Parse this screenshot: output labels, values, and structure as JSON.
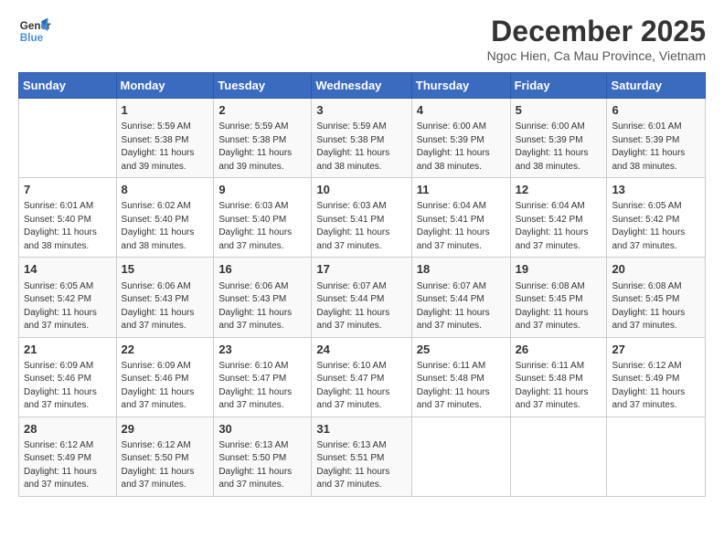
{
  "logo": {
    "line1": "General",
    "line2": "Blue"
  },
  "title": "December 2025",
  "location": "Ngoc Hien, Ca Mau Province, Vietnam",
  "days_of_week": [
    "Sunday",
    "Monday",
    "Tuesday",
    "Wednesday",
    "Thursday",
    "Friday",
    "Saturday"
  ],
  "weeks": [
    [
      {
        "num": "",
        "detail": ""
      },
      {
        "num": "1",
        "detail": "Sunrise: 5:59 AM\nSunset: 5:38 PM\nDaylight: 11 hours\nand 39 minutes."
      },
      {
        "num": "2",
        "detail": "Sunrise: 5:59 AM\nSunset: 5:38 PM\nDaylight: 11 hours\nand 39 minutes."
      },
      {
        "num": "3",
        "detail": "Sunrise: 5:59 AM\nSunset: 5:38 PM\nDaylight: 11 hours\nand 38 minutes."
      },
      {
        "num": "4",
        "detail": "Sunrise: 6:00 AM\nSunset: 5:39 PM\nDaylight: 11 hours\nand 38 minutes."
      },
      {
        "num": "5",
        "detail": "Sunrise: 6:00 AM\nSunset: 5:39 PM\nDaylight: 11 hours\nand 38 minutes."
      },
      {
        "num": "6",
        "detail": "Sunrise: 6:01 AM\nSunset: 5:39 PM\nDaylight: 11 hours\nand 38 minutes."
      }
    ],
    [
      {
        "num": "7",
        "detail": "Sunrise: 6:01 AM\nSunset: 5:40 PM\nDaylight: 11 hours\nand 38 minutes."
      },
      {
        "num": "8",
        "detail": "Sunrise: 6:02 AM\nSunset: 5:40 PM\nDaylight: 11 hours\nand 38 minutes."
      },
      {
        "num": "9",
        "detail": "Sunrise: 6:03 AM\nSunset: 5:40 PM\nDaylight: 11 hours\nand 37 minutes."
      },
      {
        "num": "10",
        "detail": "Sunrise: 6:03 AM\nSunset: 5:41 PM\nDaylight: 11 hours\nand 37 minutes."
      },
      {
        "num": "11",
        "detail": "Sunrise: 6:04 AM\nSunset: 5:41 PM\nDaylight: 11 hours\nand 37 minutes."
      },
      {
        "num": "12",
        "detail": "Sunrise: 6:04 AM\nSunset: 5:42 PM\nDaylight: 11 hours\nand 37 minutes."
      },
      {
        "num": "13",
        "detail": "Sunrise: 6:05 AM\nSunset: 5:42 PM\nDaylight: 11 hours\nand 37 minutes."
      }
    ],
    [
      {
        "num": "14",
        "detail": "Sunrise: 6:05 AM\nSunset: 5:42 PM\nDaylight: 11 hours\nand 37 minutes."
      },
      {
        "num": "15",
        "detail": "Sunrise: 6:06 AM\nSunset: 5:43 PM\nDaylight: 11 hours\nand 37 minutes."
      },
      {
        "num": "16",
        "detail": "Sunrise: 6:06 AM\nSunset: 5:43 PM\nDaylight: 11 hours\nand 37 minutes."
      },
      {
        "num": "17",
        "detail": "Sunrise: 6:07 AM\nSunset: 5:44 PM\nDaylight: 11 hours\nand 37 minutes."
      },
      {
        "num": "18",
        "detail": "Sunrise: 6:07 AM\nSunset: 5:44 PM\nDaylight: 11 hours\nand 37 minutes."
      },
      {
        "num": "19",
        "detail": "Sunrise: 6:08 AM\nSunset: 5:45 PM\nDaylight: 11 hours\nand 37 minutes."
      },
      {
        "num": "20",
        "detail": "Sunrise: 6:08 AM\nSunset: 5:45 PM\nDaylight: 11 hours\nand 37 minutes."
      }
    ],
    [
      {
        "num": "21",
        "detail": "Sunrise: 6:09 AM\nSunset: 5:46 PM\nDaylight: 11 hours\nand 37 minutes."
      },
      {
        "num": "22",
        "detail": "Sunrise: 6:09 AM\nSunset: 5:46 PM\nDaylight: 11 hours\nand 37 minutes."
      },
      {
        "num": "23",
        "detail": "Sunrise: 6:10 AM\nSunset: 5:47 PM\nDaylight: 11 hours\nand 37 minutes."
      },
      {
        "num": "24",
        "detail": "Sunrise: 6:10 AM\nSunset: 5:47 PM\nDaylight: 11 hours\nand 37 minutes."
      },
      {
        "num": "25",
        "detail": "Sunrise: 6:11 AM\nSunset: 5:48 PM\nDaylight: 11 hours\nand 37 minutes."
      },
      {
        "num": "26",
        "detail": "Sunrise: 6:11 AM\nSunset: 5:48 PM\nDaylight: 11 hours\nand 37 minutes."
      },
      {
        "num": "27",
        "detail": "Sunrise: 6:12 AM\nSunset: 5:49 PM\nDaylight: 11 hours\nand 37 minutes."
      }
    ],
    [
      {
        "num": "28",
        "detail": "Sunrise: 6:12 AM\nSunset: 5:49 PM\nDaylight: 11 hours\nand 37 minutes."
      },
      {
        "num": "29",
        "detail": "Sunrise: 6:12 AM\nSunset: 5:50 PM\nDaylight: 11 hours\nand 37 minutes."
      },
      {
        "num": "30",
        "detail": "Sunrise: 6:13 AM\nSunset: 5:50 PM\nDaylight: 11 hours\nand 37 minutes."
      },
      {
        "num": "31",
        "detail": "Sunrise: 6:13 AM\nSunset: 5:51 PM\nDaylight: 11 hours\nand 37 minutes."
      },
      {
        "num": "",
        "detail": ""
      },
      {
        "num": "",
        "detail": ""
      },
      {
        "num": "",
        "detail": ""
      }
    ]
  ]
}
